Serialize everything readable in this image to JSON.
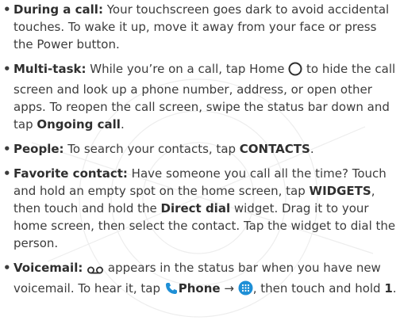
{
  "items": [
    {
      "term": "During a call:",
      "text": " Your touchscreen goes dark to avoid accidental touches. To wake it up, move it away from your face or press the Power button."
    },
    {
      "term": "Multi-task:",
      "text_a": " While you’re on a call, tap Home ",
      "text_b": " to hide the call screen and look up a phone number, address, or open other apps. To reopen the call screen, swipe the status bar down and tap ",
      "bold_end": "Ongoing call",
      "text_end": "."
    },
    {
      "term": "People:",
      "text": " To search your contacts, tap ",
      "bold_end": "CONTACTS",
      "text_end": "."
    },
    {
      "term": "Favorite contact:",
      "text_a": " Have someone you call all the time? Touch and hold an empty spot on the home screen, tap ",
      "bold_1": "WIDGETS",
      "text_b": ", then touch and hold the ",
      "bold_2": "Direct dial",
      "text_c": "  widget. Drag it to your home screen, then select the contact. Tap the widget to dial the person."
    },
    {
      "term": "Voicemail:",
      "text_a": " appears in the status bar when you have new voicemail. To hear it, tap ",
      "bold_1": "Phone",
      "arrow": " → ",
      "text_b": ", then touch and hold ",
      "bold_2": "1",
      "text_end": "."
    }
  ],
  "bullet_char": "•",
  "icons": [
    "home-circle-icon",
    "voicemail-icon",
    "phone-icon",
    "dialpad-icon"
  ],
  "colors": {
    "text": "#3c3c3c",
    "accent_blue": "#1e8fd6"
  }
}
